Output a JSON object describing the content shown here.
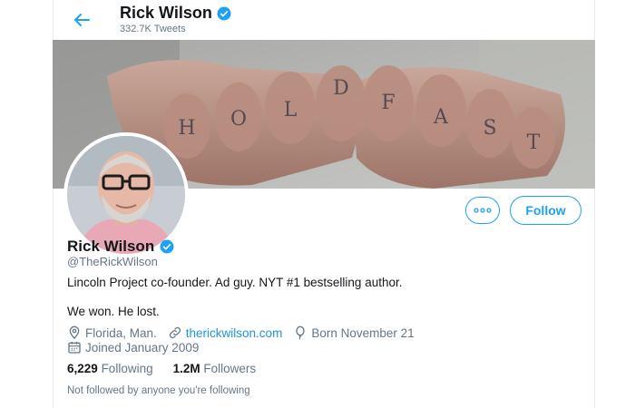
{
  "header": {
    "name": "Rick Wilson",
    "tweet_count": "332.7K Tweets"
  },
  "banner": {
    "knuckle_letters": [
      "H",
      "O",
      "L",
      "D",
      "F",
      "A",
      "S",
      "T"
    ]
  },
  "profile": {
    "name": "Rick Wilson",
    "handle": "@TheRickWilson",
    "bio_line1": "Lincoln Project co-founder. Ad guy. NYT #1 bestselling author.",
    "bio_line2": "We won. He lost.",
    "location": "Florida, Man.",
    "website": "therickwilson.com",
    "born": "Born November 21",
    "joined": "Joined January 2009"
  },
  "stats": {
    "following_count": "6,229",
    "following_label": "Following",
    "followers_count": "1.2M",
    "followers_label": "Followers"
  },
  "footnote": "Not followed by anyone you're following",
  "buttons": {
    "follow_label": "Follow"
  },
  "colors": {
    "accent": "#1da1f2",
    "text": "#14171a",
    "muted": "#657786"
  },
  "icons": [
    "back-arrow-icon",
    "verified-badge-icon",
    "more-options-icon",
    "location-pin-icon",
    "link-icon",
    "balloon-icon",
    "calendar-icon"
  ]
}
